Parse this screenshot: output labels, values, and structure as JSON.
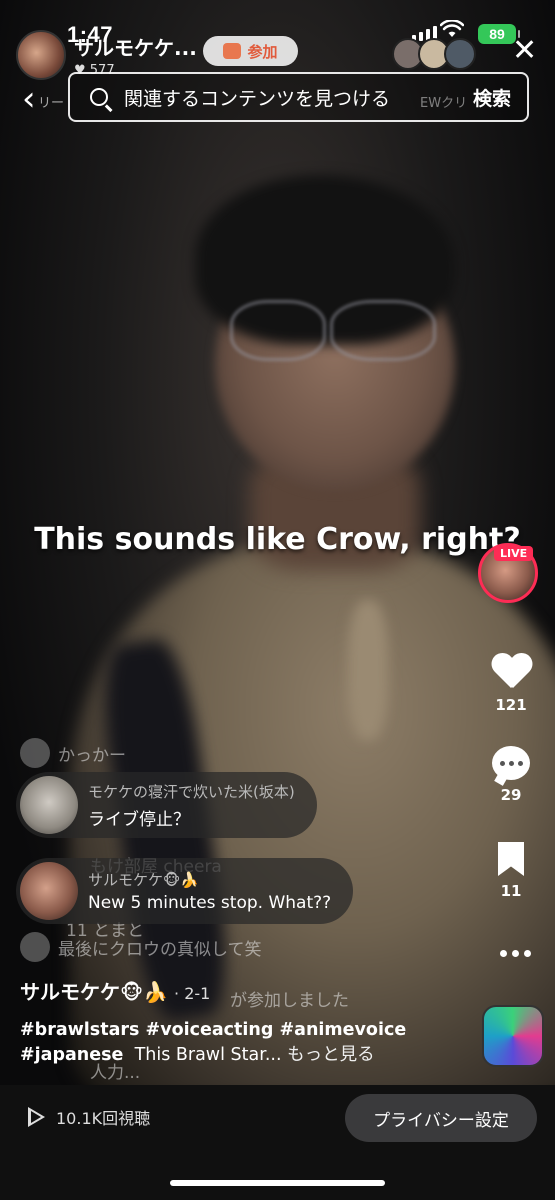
{
  "status_bar": {
    "time": "1:47",
    "battery": "89"
  },
  "host": {
    "name": "サルモケケ...",
    "likes": "♥ 577",
    "join_label": "参加"
  },
  "search": {
    "placeholder": "関連するコンテンツを見つける",
    "button": "検索",
    "bg_chip_left": "リー",
    "bg_chip_right": "EWクリ"
  },
  "caption": "This sounds like Crow, right?",
  "right_rail": {
    "live_label": "LIVE",
    "likes": "121",
    "comments": "29",
    "saves": "11"
  },
  "chat": {
    "faint": [
      {
        "text": "かっかー"
      },
      {
        "text": "もけ部屋  cheera"
      },
      {
        "text": "11  とまと"
      },
      {
        "text": "最後にクロウの真似して笑"
      },
      {
        "text": "が参加しました"
      },
      {
        "text": "人力..."
      }
    ],
    "messages": [
      {
        "user": "モケケの寝汗で炊いた米(坂本)",
        "text": "ライブ停止？"
      },
      {
        "user": "サルモケケ🐵🍌",
        "text": "New 5 minutes stop. What??"
      }
    ]
  },
  "description": {
    "username": "サルモケケ🐵🍌",
    "meta": "· 2-1",
    "hashtags_line1": "#brawlstars #voiceacting #animevoice",
    "hashtag_line2": "#japanese",
    "text": "This Brawl Star...",
    "more": "もっと見る"
  },
  "bottom": {
    "views": "10.1K回視聴",
    "privacy": "プライバシー設定"
  },
  "colors": {
    "live": "#fe2c55",
    "battery": "#34c759",
    "join": "#e15a3b"
  }
}
